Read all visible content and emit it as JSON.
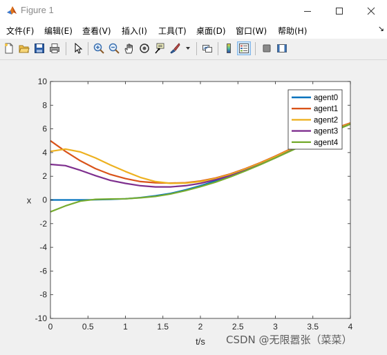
{
  "window": {
    "title": "Figure 1"
  },
  "menu": [
    {
      "key": "file",
      "label": "文件(F)"
    },
    {
      "key": "edit",
      "label": "编辑(E)"
    },
    {
      "key": "view",
      "label": "查看(V)"
    },
    {
      "key": "insert",
      "label": "插入(I)"
    },
    {
      "key": "tools",
      "label": "工具(T)"
    },
    {
      "key": "desktop",
      "label": "桌面(D)"
    },
    {
      "key": "window",
      "label": "窗口(W)"
    },
    {
      "key": "help",
      "label": "帮助(H)"
    }
  ],
  "toolbar": {
    "buttons": [
      "new-figure-icon",
      "open-file-icon",
      "save-icon",
      "print-icon",
      "select-arrow-icon",
      "zoom-in-icon",
      "zoom-out-icon",
      "pan-hand-icon",
      "rotate-3d-icon",
      "data-cursor-icon",
      "brush-icon",
      "link-plot-icon",
      "colorbar-icon",
      "legend-icon",
      "hide-plot-tools-icon",
      "show-plot-tools-icon"
    ],
    "active": "legend-icon"
  },
  "watermark": "CSDN @无限嚣张（菜菜）",
  "chart_data": {
    "type": "line",
    "xlabel": "t/s",
    "ylabel": "x",
    "xlim": [
      0,
      4
    ],
    "ylim": [
      -10,
      10
    ],
    "xticks": [
      "0",
      "0.5",
      "1",
      "1.5",
      "2",
      "2.5",
      "3",
      "3.5",
      "4"
    ],
    "yticks": [
      "10",
      "8",
      "6",
      "4",
      "2",
      "0",
      "-2",
      "-4",
      "-6",
      "-8",
      "-10"
    ],
    "grid": false,
    "legend_position": "top-right",
    "x": [
      0,
      0.2,
      0.4,
      0.6,
      0.8,
      1.0,
      1.2,
      1.4,
      1.6,
      1.8,
      2.0,
      2.2,
      2.4,
      2.6,
      2.8,
      3.0,
      3.2,
      3.4,
      3.6,
      3.8,
      4.0
    ],
    "series": [
      {
        "name": "agent0",
        "color": "#0072bd",
        "values": [
          0,
          0,
          0,
          0.02,
          0.05,
          0.1,
          0.2,
          0.35,
          0.55,
          0.85,
          1.2,
          1.6,
          2.05,
          2.55,
          3.1,
          3.65,
          4.25,
          4.85,
          5.45,
          6.0,
          6.45
        ]
      },
      {
        "name": "agent1",
        "color": "#d95319",
        "values": [
          5.0,
          4.1,
          3.3,
          2.65,
          2.15,
          1.8,
          1.55,
          1.45,
          1.42,
          1.45,
          1.6,
          1.85,
          2.2,
          2.65,
          3.15,
          3.7,
          4.3,
          4.9,
          5.5,
          6.05,
          6.5
        ]
      },
      {
        "name": "agent2",
        "color": "#edb120",
        "values": [
          4.1,
          4.3,
          4.05,
          3.55,
          2.95,
          2.4,
          1.9,
          1.55,
          1.4,
          1.42,
          1.55,
          1.8,
          2.15,
          2.6,
          3.1,
          3.65,
          4.25,
          4.85,
          5.45,
          6.0,
          6.45
        ]
      },
      {
        "name": "agent3",
        "color": "#7e2f8e",
        "values": [
          3.0,
          2.9,
          2.5,
          2.05,
          1.65,
          1.4,
          1.2,
          1.1,
          1.1,
          1.2,
          1.4,
          1.7,
          2.05,
          2.5,
          3.0,
          3.55,
          4.15,
          4.75,
          5.35,
          5.9,
          6.4
        ]
      },
      {
        "name": "agent4",
        "color": "#77ac30",
        "values": [
          -1.0,
          -0.5,
          -0.1,
          0.05,
          0.08,
          0.1,
          0.18,
          0.3,
          0.5,
          0.78,
          1.12,
          1.5,
          1.95,
          2.45,
          2.98,
          3.55,
          4.12,
          4.72,
          5.3,
          5.88,
          6.4
        ]
      }
    ]
  }
}
